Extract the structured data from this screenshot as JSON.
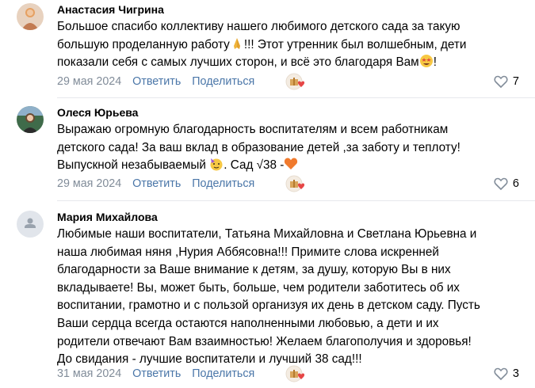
{
  "comments": [
    {
      "author": "Анастасия Чигрина",
      "lines": [
        "Большое спасибо коллективу нашего любимого детского сада за такую",
        "большую проделанную работу",
        "!!! Этот утренник был волшебным, дети",
        "показали себя с самых лучших сторон, и всё это благодаря Вам",
        "!"
      ],
      "date": "29 мая 2024",
      "reply": "Ответить",
      "share": "Поделиться",
      "likes": "7"
    },
    {
      "author": "Олеся Юрьева",
      "lines": [
        "Выражаю огромную благодарность воспитателям и всем работникам",
        "детского сада! За ваш вклад в образование детей ,за заботу и теплоту!",
        "Выпускной незабываемый",
        ". Сад √38 -"
      ],
      "date": "29 мая 2024",
      "reply": "Ответить",
      "share": "Поделиться",
      "likes": "6"
    },
    {
      "author": "Мария Михайлова",
      "lines": [
        "Любимые наши воспитатели, Татьяна Михайловна и Светлана Юрьевна и",
        "наша любимая няня ,Нурия Аббясовна!!! Примите слова искренней",
        "благодарности за Ваше внимание к детям, за душу, которую Вы в них",
        "вкладываете! Вы, может быть, больше, чем родители заботитесь об их",
        "воспитании, грамотно и с пользой организуя их день в детском саду. Пусть",
        "Ваши сердца всегда остаются наполненными любовью, а дети и их",
        "родители отвечают Вам взаимностью! Желаем благополучия и здоровья!",
        "До свидания - лучшие воспитатели и лучший 38 сад!!!"
      ],
      "date": "31 мая 2024",
      "reply": "Ответить",
      "share": "Поделиться",
      "likes": "3"
    }
  ],
  "colors": {
    "link": "#4a76a8",
    "meta": "#818c99",
    "heart": "#e64646",
    "divider": "#e7e8ec"
  },
  "icons": {
    "like": "heart-outline-icon",
    "reaction": "gift-heart-icon",
    "praying": "praying-hands-emoji",
    "starstruck": "star-struck-emoji",
    "party": "partying-face-emoji",
    "orange_heart": "orange-heart-emoji"
  }
}
